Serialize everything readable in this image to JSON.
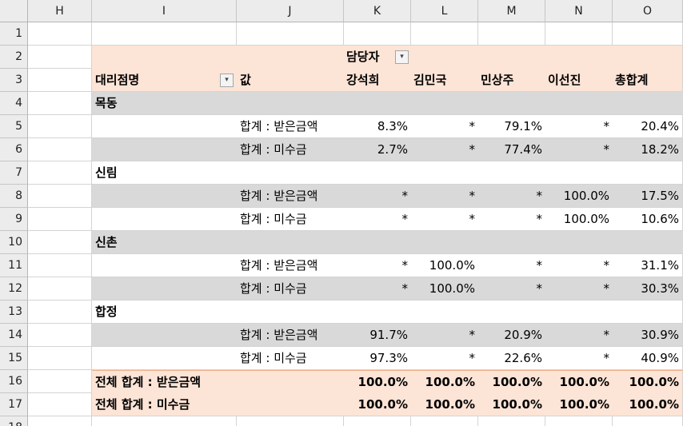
{
  "columns": [
    "H",
    "I",
    "J",
    "K",
    "L",
    "M",
    "N",
    "O"
  ],
  "row_numbers": [
    "1",
    "2",
    "3",
    "4",
    "5",
    "6",
    "7",
    "8",
    "9",
    "10",
    "11",
    "12",
    "13",
    "14",
    "15",
    "16",
    "17",
    "18"
  ],
  "pivot": {
    "header_row2_label": "담당자",
    "header_row3_label_I": "대리점명",
    "header_row3_label_J": "값",
    "person_headers": [
      "강석희",
      "김민국",
      "민상주",
      "이선진",
      "총합계"
    ],
    "dropdown_icon": "filter-dropdown-icon",
    "groups": [
      {
        "name": "목동",
        "rows": [
          {
            "label": "합계 : 받은금액",
            "values": [
              "8.3%",
              "*",
              "79.1%",
              "*",
              "20.4%"
            ]
          },
          {
            "label": "합계 : 미수금",
            "values": [
              "2.7%",
              "*",
              "77.4%",
              "*",
              "18.2%"
            ]
          }
        ]
      },
      {
        "name": "신림",
        "rows": [
          {
            "label": "합계 : 받은금액",
            "values": [
              "*",
              "*",
              "*",
              "100.0%",
              "17.5%"
            ]
          },
          {
            "label": "합계 : 미수금",
            "values": [
              "*",
              "*",
              "*",
              "100.0%",
              "10.6%"
            ]
          }
        ]
      },
      {
        "name": "신촌",
        "rows": [
          {
            "label": "합계 : 받은금액",
            "values": [
              "*",
              "100.0%",
              "*",
              "*",
              "31.1%"
            ]
          },
          {
            "label": "합계 : 미수금",
            "values": [
              "*",
              "100.0%",
              "*",
              "*",
              "30.3%"
            ]
          }
        ]
      },
      {
        "name": "합정",
        "rows": [
          {
            "label": "합계 : 받은금액",
            "values": [
              "91.7%",
              "*",
              "20.9%",
              "*",
              "30.9%"
            ]
          },
          {
            "label": "합계 : 미수금",
            "values": [
              "97.3%",
              "*",
              "22.6%",
              "*",
              "40.9%"
            ]
          }
        ]
      }
    ],
    "totals": [
      {
        "label": "전체 합계 : 받은금액",
        "values": [
          "100.0%",
          "100.0%",
          "100.0%",
          "100.0%",
          "100.0%"
        ]
      },
      {
        "label": "전체 합계 : 미수금",
        "values": [
          "100.0%",
          "100.0%",
          "100.0%",
          "100.0%",
          "100.0%"
        ]
      }
    ]
  },
  "colors": {
    "header_peach": "#fce4d6",
    "band_gray": "#d9d9d9",
    "grid": "#d4d4d4"
  }
}
